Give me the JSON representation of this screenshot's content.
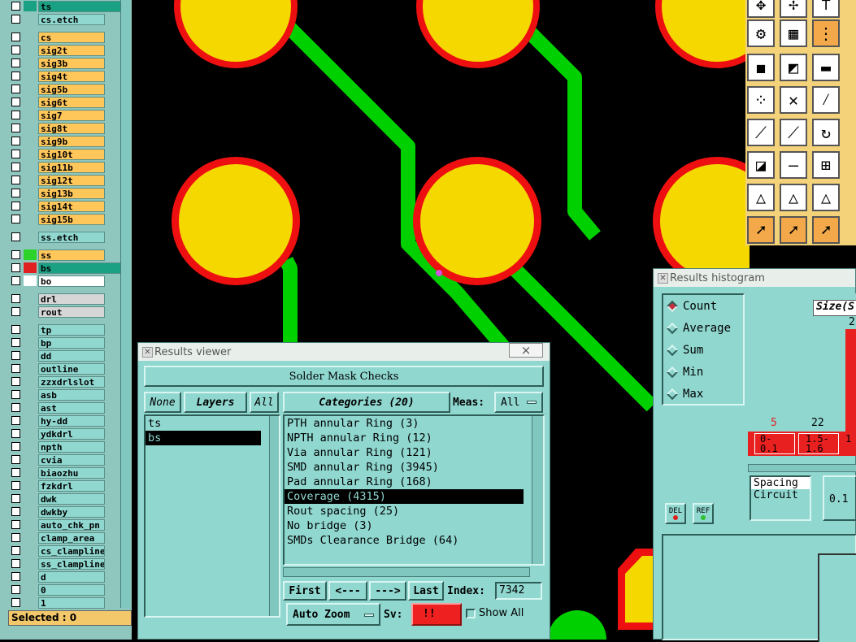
{
  "layers": [
    {
      "name": "ts",
      "color": "sel",
      "swatch": "#1aa184"
    },
    {
      "name": "cs.etch",
      "color": "teal"
    },
    {
      "name": "cs",
      "color": "orange"
    },
    {
      "name": "sig2t",
      "color": "orange"
    },
    {
      "name": "sig3b",
      "color": "orange"
    },
    {
      "name": "sig4t",
      "color": "orange"
    },
    {
      "name": "sig5b",
      "color": "orange"
    },
    {
      "name": "sig6t",
      "color": "orange"
    },
    {
      "name": "sig7",
      "color": "orange"
    },
    {
      "name": "sig8t",
      "color": "orange"
    },
    {
      "name": "sig9b",
      "color": "orange"
    },
    {
      "name": "sig10t",
      "color": "orange"
    },
    {
      "name": "sig11b",
      "color": "orange"
    },
    {
      "name": "sig12t",
      "color": "orange"
    },
    {
      "name": "sig13b",
      "color": "orange"
    },
    {
      "name": "sig14t",
      "color": "orange"
    },
    {
      "name": "sig15b",
      "color": "orange"
    },
    {
      "name": "ss.etch",
      "color": "teal"
    },
    {
      "name": "ss",
      "color": "orange",
      "swatch": "#2bd32b"
    },
    {
      "name": "bs",
      "color": "sel",
      "swatch": "#e02020"
    },
    {
      "name": "bo",
      "color": "white",
      "swatch": ""
    },
    {
      "name": "drl",
      "color": "grey"
    },
    {
      "name": "rout",
      "color": "grey"
    },
    {
      "name": "tp",
      "color": "teal"
    },
    {
      "name": "bp",
      "color": "teal"
    },
    {
      "name": "dd",
      "color": "teal"
    },
    {
      "name": "outline",
      "color": "teal"
    },
    {
      "name": "zzxdrlslot",
      "color": "teal"
    },
    {
      "name": "asb",
      "color": "teal"
    },
    {
      "name": "ast",
      "color": "teal"
    },
    {
      "name": "hy-dd",
      "color": "teal"
    },
    {
      "name": "ydkdrl",
      "color": "teal"
    },
    {
      "name": "npth",
      "color": "teal"
    },
    {
      "name": "cvia",
      "color": "teal"
    },
    {
      "name": "biaozhu",
      "color": "teal"
    },
    {
      "name": "fzkdrl",
      "color": "teal"
    },
    {
      "name": "dwk",
      "color": "teal"
    },
    {
      "name": "dwkby",
      "color": "teal"
    },
    {
      "name": "auto_chk_pn",
      "color": "teal"
    },
    {
      "name": "clamp_area",
      "color": "teal"
    },
    {
      "name": "cs_clampline",
      "color": "teal"
    },
    {
      "name": "ss_clampline",
      "color": "teal"
    },
    {
      "name": "d",
      "color": "teal"
    },
    {
      "name": "0",
      "color": "teal"
    },
    {
      "name": "1",
      "color": "teal"
    }
  ],
  "selected": "Selected : 0",
  "viewer": {
    "title": "Results viewer",
    "header": "Solder Mask Checks",
    "btn_none": "None",
    "btn_layers": "Layers",
    "btn_all": "All",
    "categories": "Categories (20)",
    "meas_label": "Meas:",
    "meas_value": "All",
    "layer_list": [
      "ts",
      "bs"
    ],
    "cat_list": [
      "PTH annular Ring (3)",
      "NPTH annular Ring (12)",
      "Via annular Ring (121)",
      "SMD annular Ring (3945)",
      "Pad annular Ring (168)",
      "Coverage (4315)",
      "Rout spacing (25)",
      "No bridge (3)",
      "SMDs Clearance Bridge (64)"
    ],
    "btn_first": "First",
    "btn_prev": "<---",
    "btn_next": "--->",
    "btn_last": "Last",
    "index_label": "Index:",
    "index_value": "7342",
    "auto_zoom": "Auto Zoom",
    "sv_label": "Sv:",
    "sv_value": "!!",
    "show_all": "Show All",
    "close": "×"
  },
  "histogram": {
    "title": "Results histogram",
    "radios": [
      "Count",
      "Average",
      "Sum",
      "Min",
      "Max"
    ],
    "size_label": "Size(S",
    "bar_top": "2",
    "axis_vals": [
      "5",
      "22"
    ],
    "bins": [
      "0-\n0.1",
      "1.5-\n1.6",
      "1"
    ],
    "types": [
      "Spacing",
      "Circuit"
    ],
    "value": "0.1",
    "del": "DEL",
    "ref": "REF"
  },
  "colors": {
    "pad": "#f5d800",
    "ring": "#ee1010",
    "trace": "#00d000",
    "panel": "#8fd7cf"
  }
}
